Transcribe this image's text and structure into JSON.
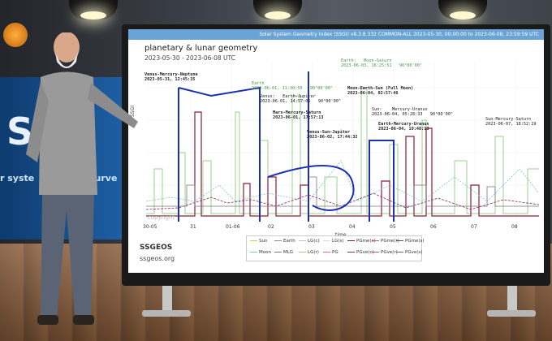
{
  "chart_page": {
    "topbar": "Solar System Geometry Index (SSGI) v8.3.8.332 COMMON-ALL 2023-05-30, 00:00:00 to 2023-06-08, 23:59:59 UTC",
    "title": "planetary & lunar geometry",
    "subtitle": "2023-05-30 - 2023-06-08 UTC",
    "ylabel": "SSGI",
    "xlabel": "time",
    "watermark": "copyright",
    "brand": "SSGEOS",
    "brand_url": "ssgeos.org"
  },
  "annotations": [
    {
      "text": "Venus-Mercury-Neptune\n2023-05-31, 12:45:35",
      "style": "b"
    },
    {
      "text": "Earth\n2023-06-01, 11:30:50   90°00'00\"",
      "style": "g"
    },
    {
      "text": "Venus:   Earth-Jupiter\n2023-06-01, 14:57:05   90°00'00\"",
      "style": ""
    },
    {
      "text": "Mars-Mercury-Saturn\n2023-06-01, 17:57:13",
      "style": "b"
    },
    {
      "text": "Venus-Sun-Jupiter\n2023-06-02, 17:44:32",
      "style": "b"
    },
    {
      "text": "Earth:   Moon-Saturn\n2023-06-03, 16:25:51   90°00'00\"",
      "style": "g"
    },
    {
      "text": "Moon-Earth-Sun (Full Moon)\n2023-06-04, 02:57:46",
      "style": "b"
    },
    {
      "text": "Sun:    Mercury-Uranus\n2023-06-04, 05:28:33   90°00'00\"",
      "style": ""
    },
    {
      "text": "Earth-Mercury-Uranus\n2023-06-04, 19:48:13",
      "style": "b"
    },
    {
      "text": "Sun-Mercury-Saturn\n2023-06-07, 18:52:19",
      "style": ""
    }
  ],
  "xticks": [
    "30-05",
    "31",
    "01-06",
    "02",
    "03",
    "04",
    "05",
    "06",
    "07",
    "08"
  ],
  "legend": [
    "Sun",
    "Earth",
    "LG(c)",
    "LG(s)",
    "PGme(c)",
    "PGme(r)",
    "PGme(s)",
    "Moon",
    "MLG",
    "LG(r)",
    "PG",
    "PGve(c)",
    "PGve(r)",
    "PGve(s)"
  ],
  "legend_colors": [
    "#e5c84a",
    "#8f8f8f",
    "#b0d59e",
    "#cfe7c6",
    "#8c1c3a",
    "#c06080",
    "#555555",
    "#7bc6d8",
    "#777777",
    "#9ad08a",
    "#d46a8a",
    "#8a2a6a",
    "#b05090",
    "#666666"
  ],
  "backdrop": {
    "panel_text_1": "SSG",
    "panel_text_2": "r syste",
    "panel_text_3": "surve"
  },
  "tv": {
    "logo": "SSGEOS"
  }
}
